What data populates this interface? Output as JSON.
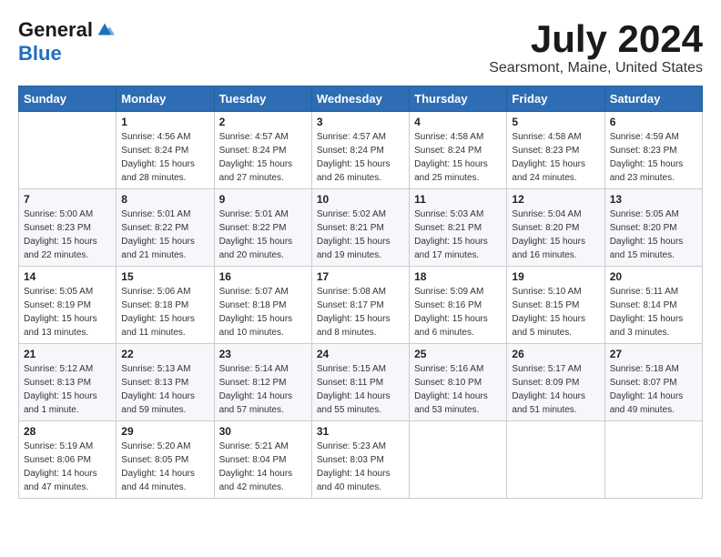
{
  "header": {
    "logo_general": "General",
    "logo_blue": "Blue",
    "month_title": "July 2024",
    "location": "Searsmont, Maine, United States"
  },
  "weekdays": [
    "Sunday",
    "Monday",
    "Tuesday",
    "Wednesday",
    "Thursday",
    "Friday",
    "Saturday"
  ],
  "weeks": [
    [
      {
        "day": "",
        "info": ""
      },
      {
        "day": "1",
        "info": "Sunrise: 4:56 AM\nSunset: 8:24 PM\nDaylight: 15 hours\nand 28 minutes."
      },
      {
        "day": "2",
        "info": "Sunrise: 4:57 AM\nSunset: 8:24 PM\nDaylight: 15 hours\nand 27 minutes."
      },
      {
        "day": "3",
        "info": "Sunrise: 4:57 AM\nSunset: 8:24 PM\nDaylight: 15 hours\nand 26 minutes."
      },
      {
        "day": "4",
        "info": "Sunrise: 4:58 AM\nSunset: 8:24 PM\nDaylight: 15 hours\nand 25 minutes."
      },
      {
        "day": "5",
        "info": "Sunrise: 4:58 AM\nSunset: 8:23 PM\nDaylight: 15 hours\nand 24 minutes."
      },
      {
        "day": "6",
        "info": "Sunrise: 4:59 AM\nSunset: 8:23 PM\nDaylight: 15 hours\nand 23 minutes."
      }
    ],
    [
      {
        "day": "7",
        "info": "Sunrise: 5:00 AM\nSunset: 8:23 PM\nDaylight: 15 hours\nand 22 minutes."
      },
      {
        "day": "8",
        "info": "Sunrise: 5:01 AM\nSunset: 8:22 PM\nDaylight: 15 hours\nand 21 minutes."
      },
      {
        "day": "9",
        "info": "Sunrise: 5:01 AM\nSunset: 8:22 PM\nDaylight: 15 hours\nand 20 minutes."
      },
      {
        "day": "10",
        "info": "Sunrise: 5:02 AM\nSunset: 8:21 PM\nDaylight: 15 hours\nand 19 minutes."
      },
      {
        "day": "11",
        "info": "Sunrise: 5:03 AM\nSunset: 8:21 PM\nDaylight: 15 hours\nand 17 minutes."
      },
      {
        "day": "12",
        "info": "Sunrise: 5:04 AM\nSunset: 8:20 PM\nDaylight: 15 hours\nand 16 minutes."
      },
      {
        "day": "13",
        "info": "Sunrise: 5:05 AM\nSunset: 8:20 PM\nDaylight: 15 hours\nand 15 minutes."
      }
    ],
    [
      {
        "day": "14",
        "info": "Sunrise: 5:05 AM\nSunset: 8:19 PM\nDaylight: 15 hours\nand 13 minutes."
      },
      {
        "day": "15",
        "info": "Sunrise: 5:06 AM\nSunset: 8:18 PM\nDaylight: 15 hours\nand 11 minutes."
      },
      {
        "day": "16",
        "info": "Sunrise: 5:07 AM\nSunset: 8:18 PM\nDaylight: 15 hours\nand 10 minutes."
      },
      {
        "day": "17",
        "info": "Sunrise: 5:08 AM\nSunset: 8:17 PM\nDaylight: 15 hours\nand 8 minutes."
      },
      {
        "day": "18",
        "info": "Sunrise: 5:09 AM\nSunset: 8:16 PM\nDaylight: 15 hours\nand 6 minutes."
      },
      {
        "day": "19",
        "info": "Sunrise: 5:10 AM\nSunset: 8:15 PM\nDaylight: 15 hours\nand 5 minutes."
      },
      {
        "day": "20",
        "info": "Sunrise: 5:11 AM\nSunset: 8:14 PM\nDaylight: 15 hours\nand 3 minutes."
      }
    ],
    [
      {
        "day": "21",
        "info": "Sunrise: 5:12 AM\nSunset: 8:13 PM\nDaylight: 15 hours\nand 1 minute."
      },
      {
        "day": "22",
        "info": "Sunrise: 5:13 AM\nSunset: 8:13 PM\nDaylight: 14 hours\nand 59 minutes."
      },
      {
        "day": "23",
        "info": "Sunrise: 5:14 AM\nSunset: 8:12 PM\nDaylight: 14 hours\nand 57 minutes."
      },
      {
        "day": "24",
        "info": "Sunrise: 5:15 AM\nSunset: 8:11 PM\nDaylight: 14 hours\nand 55 minutes."
      },
      {
        "day": "25",
        "info": "Sunrise: 5:16 AM\nSunset: 8:10 PM\nDaylight: 14 hours\nand 53 minutes."
      },
      {
        "day": "26",
        "info": "Sunrise: 5:17 AM\nSunset: 8:09 PM\nDaylight: 14 hours\nand 51 minutes."
      },
      {
        "day": "27",
        "info": "Sunrise: 5:18 AM\nSunset: 8:07 PM\nDaylight: 14 hours\nand 49 minutes."
      }
    ],
    [
      {
        "day": "28",
        "info": "Sunrise: 5:19 AM\nSunset: 8:06 PM\nDaylight: 14 hours\nand 47 minutes."
      },
      {
        "day": "29",
        "info": "Sunrise: 5:20 AM\nSunset: 8:05 PM\nDaylight: 14 hours\nand 44 minutes."
      },
      {
        "day": "30",
        "info": "Sunrise: 5:21 AM\nSunset: 8:04 PM\nDaylight: 14 hours\nand 42 minutes."
      },
      {
        "day": "31",
        "info": "Sunrise: 5:23 AM\nSunset: 8:03 PM\nDaylight: 14 hours\nand 40 minutes."
      },
      {
        "day": "",
        "info": ""
      },
      {
        "day": "",
        "info": ""
      },
      {
        "day": "",
        "info": ""
      }
    ]
  ]
}
